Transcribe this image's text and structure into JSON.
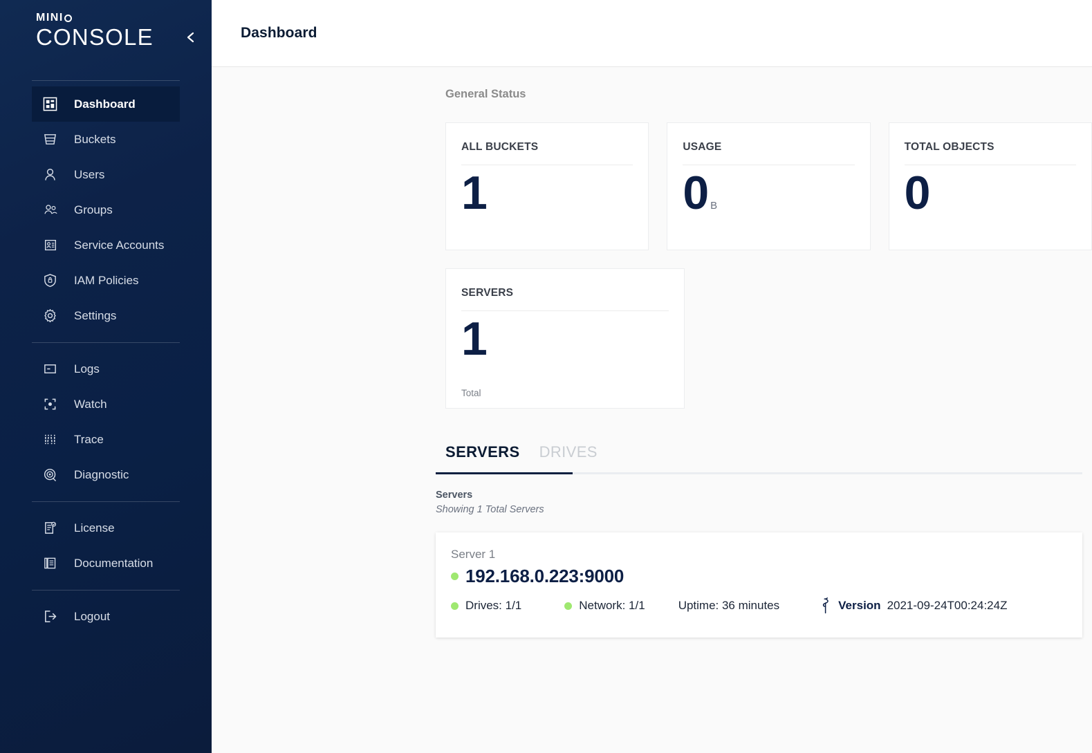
{
  "sidebar": {
    "logo_primary": "MIN",
    "logo_primary_suffix": "I",
    "logo_secondary": "CONSOLE",
    "collapse_icon": "chevron-left-icon",
    "items": [
      {
        "label": "Dashboard",
        "icon": "dashboard-grid-icon",
        "active": true
      },
      {
        "label": "Buckets",
        "icon": "bucket-icon",
        "active": false
      },
      {
        "label": "Users",
        "icon": "user-icon",
        "active": false
      },
      {
        "label": "Groups",
        "icon": "groups-icon",
        "active": false
      },
      {
        "label": "Service Accounts",
        "icon": "id-card-icon",
        "active": false
      },
      {
        "label": "IAM Policies",
        "icon": "shield-lock-icon",
        "active": false
      },
      {
        "label": "Settings",
        "icon": "gear-icon",
        "active": false
      },
      {
        "label": "Logs",
        "icon": "logs-icon",
        "active": false
      },
      {
        "label": "Watch",
        "icon": "watch-target-icon",
        "active": false
      },
      {
        "label": "Trace",
        "icon": "trace-icon",
        "active": false
      },
      {
        "label": "Diagnostic",
        "icon": "diagnostic-icon",
        "active": false
      },
      {
        "label": "License",
        "icon": "license-doc-icon",
        "active": false
      },
      {
        "label": "Documentation",
        "icon": "documentation-icon",
        "active": false
      },
      {
        "label": "Logout",
        "icon": "logout-icon",
        "active": false
      }
    ]
  },
  "header": {
    "title": "Dashboard"
  },
  "general_status": {
    "label": "General Status",
    "cards": [
      {
        "title": "ALL BUCKETS",
        "value": "1",
        "unit": "",
        "foot": ""
      },
      {
        "title": "USAGE",
        "value": "0",
        "unit": "B",
        "foot": ""
      },
      {
        "title": "TOTAL OBJECTS",
        "value": "0",
        "unit": "",
        "foot": ""
      },
      {
        "title": "SERVERS",
        "value": "1",
        "unit": "",
        "foot": "Total"
      }
    ]
  },
  "tabs": [
    {
      "label": "SERVERS",
      "active": true
    },
    {
      "label": "DRIVES",
      "active": false
    }
  ],
  "listing": {
    "title": "Servers",
    "subtitle": "Showing 1 Total Servers"
  },
  "server": {
    "name": "Server 1",
    "host": "192.168.0.223:9000",
    "drives_label": "Drives: 1/1",
    "network_label": "Network: 1/1",
    "uptime_label": "Uptime: 36 minutes",
    "version_label": "Version",
    "version_value": "2021-09-24T00:24:24Z",
    "version_icon": "minio-bird-icon",
    "status_color": "#9fe870"
  },
  "colors": {
    "sidebar_top": "#102a52",
    "sidebar_bottom": "#0b1c3c",
    "accent_navy": "#0d1f45",
    "status_green": "#9fe870",
    "content_bg": "#fafafa"
  }
}
